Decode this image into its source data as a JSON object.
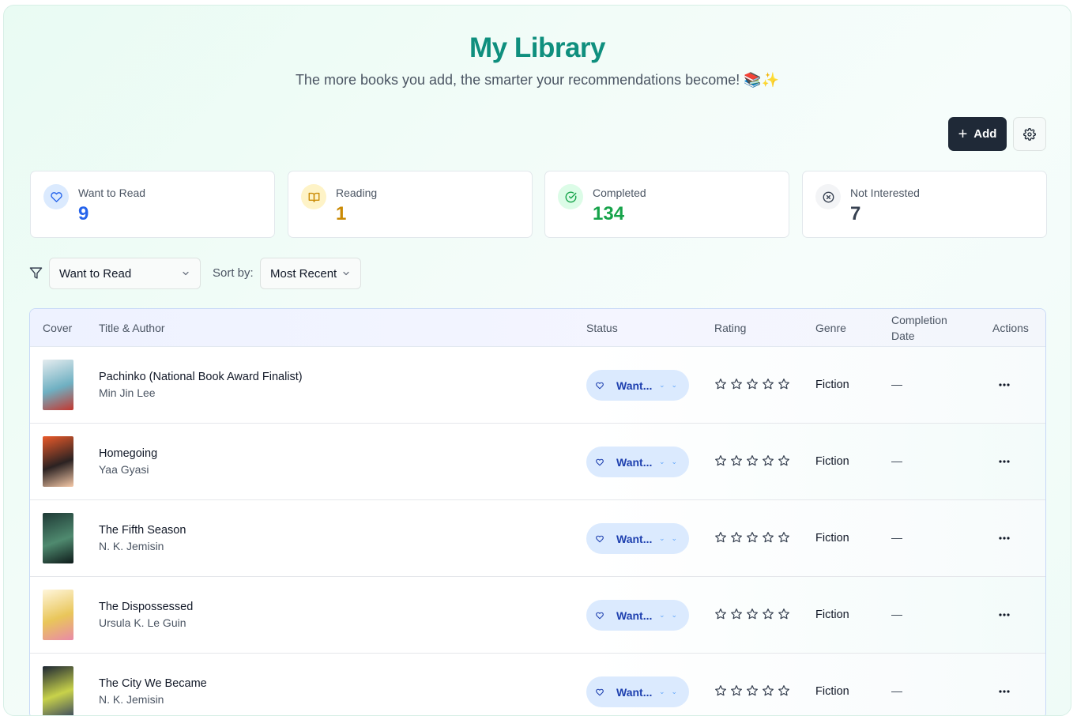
{
  "header": {
    "title": "My Library",
    "subtitle": "The more books you add, the smarter your recommendations become! 📚✨"
  },
  "toolbar": {
    "add_label": "Add",
    "add_icon": "plus-icon",
    "settings_icon": "gear-icon"
  },
  "stats": [
    {
      "label": "Want to Read",
      "value": "9",
      "icon": "heart-icon",
      "color": "#2563eb",
      "icon_bg": "#dbeafe"
    },
    {
      "label": "Reading",
      "value": "1",
      "icon": "book-open-icon",
      "color": "#ca8a04",
      "icon_bg": "#fef3c7"
    },
    {
      "label": "Completed",
      "value": "134",
      "icon": "check-circle-icon",
      "color": "#16a34a",
      "icon_bg": "#dcfce7"
    },
    {
      "label": "Not Interested",
      "value": "7",
      "icon": "x-circle-icon",
      "color": "#374151",
      "icon_bg": "#f3f4f6"
    }
  ],
  "filters": {
    "status_value": "Want to Read",
    "sort_label": "Sort by:",
    "sort_value": "Most Recent"
  },
  "table": {
    "headers": {
      "cover": "Cover",
      "title_author": "Title & Author",
      "status": "Status",
      "rating": "Rating",
      "genre": "Genre",
      "completion_line1": "Completion",
      "completion_line2": "Date",
      "actions": "Actions"
    },
    "rows": [
      {
        "title": "Pachinko (National Book Award Finalist)",
        "author": "Min Jin Lee",
        "status": "Want...",
        "rating": 0,
        "genre": "Fiction",
        "completion": "—",
        "cover_colors": [
          "#e5ecef",
          "#6fb0c2",
          "#c4372f"
        ]
      },
      {
        "title": "Homegoing",
        "author": "Yaa Gyasi",
        "status": "Want...",
        "rating": 0,
        "genre": "Fiction",
        "completion": "—",
        "cover_colors": [
          "#ea5a2a",
          "#2b2222",
          "#f6c9a8"
        ]
      },
      {
        "title": "The Fifth Season",
        "author": "N. K. Jemisin",
        "status": "Want...",
        "rating": 0,
        "genre": "Fiction",
        "completion": "—",
        "cover_colors": [
          "#1f3a36",
          "#4f8a6f",
          "#0e1b1a"
        ]
      },
      {
        "title": "The Dispossessed",
        "author": "Ursula K. Le Guin",
        "status": "Want...",
        "rating": 0,
        "genre": "Fiction",
        "completion": "—",
        "cover_colors": [
          "#fff6dc",
          "#e9c65a",
          "#e98aa8"
        ]
      },
      {
        "title": "The City We Became",
        "author": "N. K. Jemisin",
        "status": "Want...",
        "rating": 0,
        "genre": "Fiction",
        "completion": "—",
        "cover_colors": [
          "#1c2533",
          "#c8d24a",
          "#3c4a5e"
        ]
      }
    ]
  }
}
